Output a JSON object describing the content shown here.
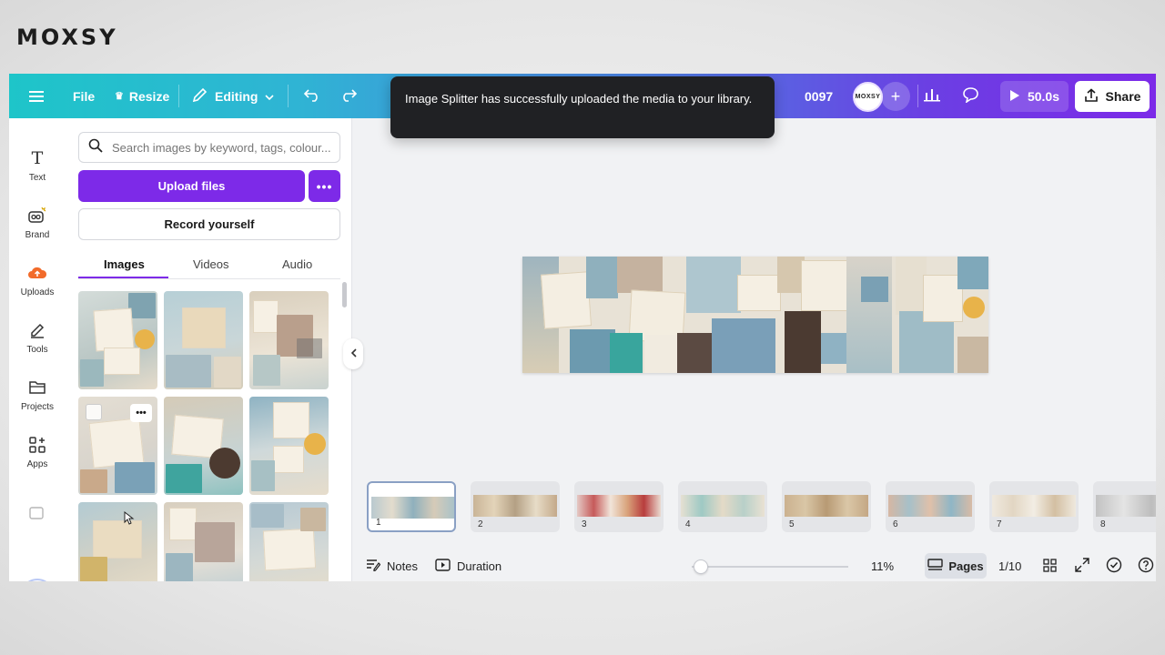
{
  "brand": "MOXSY",
  "topbar": {
    "file": "File",
    "resize": "Resize",
    "editing": "Editing",
    "doc_title": "0097",
    "avatar_text": "MOXSY",
    "play_duration": "50.0s",
    "share": "Share",
    "gradient": [
      "#1ec5c9",
      "#4b7fe0",
      "#7c2ae8"
    ]
  },
  "toast": {
    "message": "Image Splitter has successfully uploaded the media to your library."
  },
  "rail": {
    "items": [
      {
        "label": "Text",
        "icon": "text-icon"
      },
      {
        "label": "Brand",
        "icon": "brand-icon"
      },
      {
        "label": "Uploads",
        "icon": "uploads-icon"
      },
      {
        "label": "Tools",
        "icon": "tools-icon"
      },
      {
        "label": "Projects",
        "icon": "projects-icon"
      },
      {
        "label": "Apps",
        "icon": "apps-icon"
      }
    ]
  },
  "panel": {
    "search_placeholder": "Search images by keyword, tags, colour...",
    "upload_label": "Upload files",
    "record_label": "Record yourself",
    "tabs": [
      {
        "label": "Images",
        "active": true
      },
      {
        "label": "Videos",
        "active": false
      },
      {
        "label": "Audio",
        "active": false
      }
    ],
    "accent": "#7d2ae8"
  },
  "pages": {
    "thumbnails": [
      "1",
      "2",
      "3",
      "4",
      "5",
      "6",
      "7",
      "8"
    ],
    "active": 1
  },
  "bottombar": {
    "notes": "Notes",
    "duration": "Duration",
    "zoom": "11%",
    "pages_label": "Pages",
    "page_counter": "1/10"
  }
}
